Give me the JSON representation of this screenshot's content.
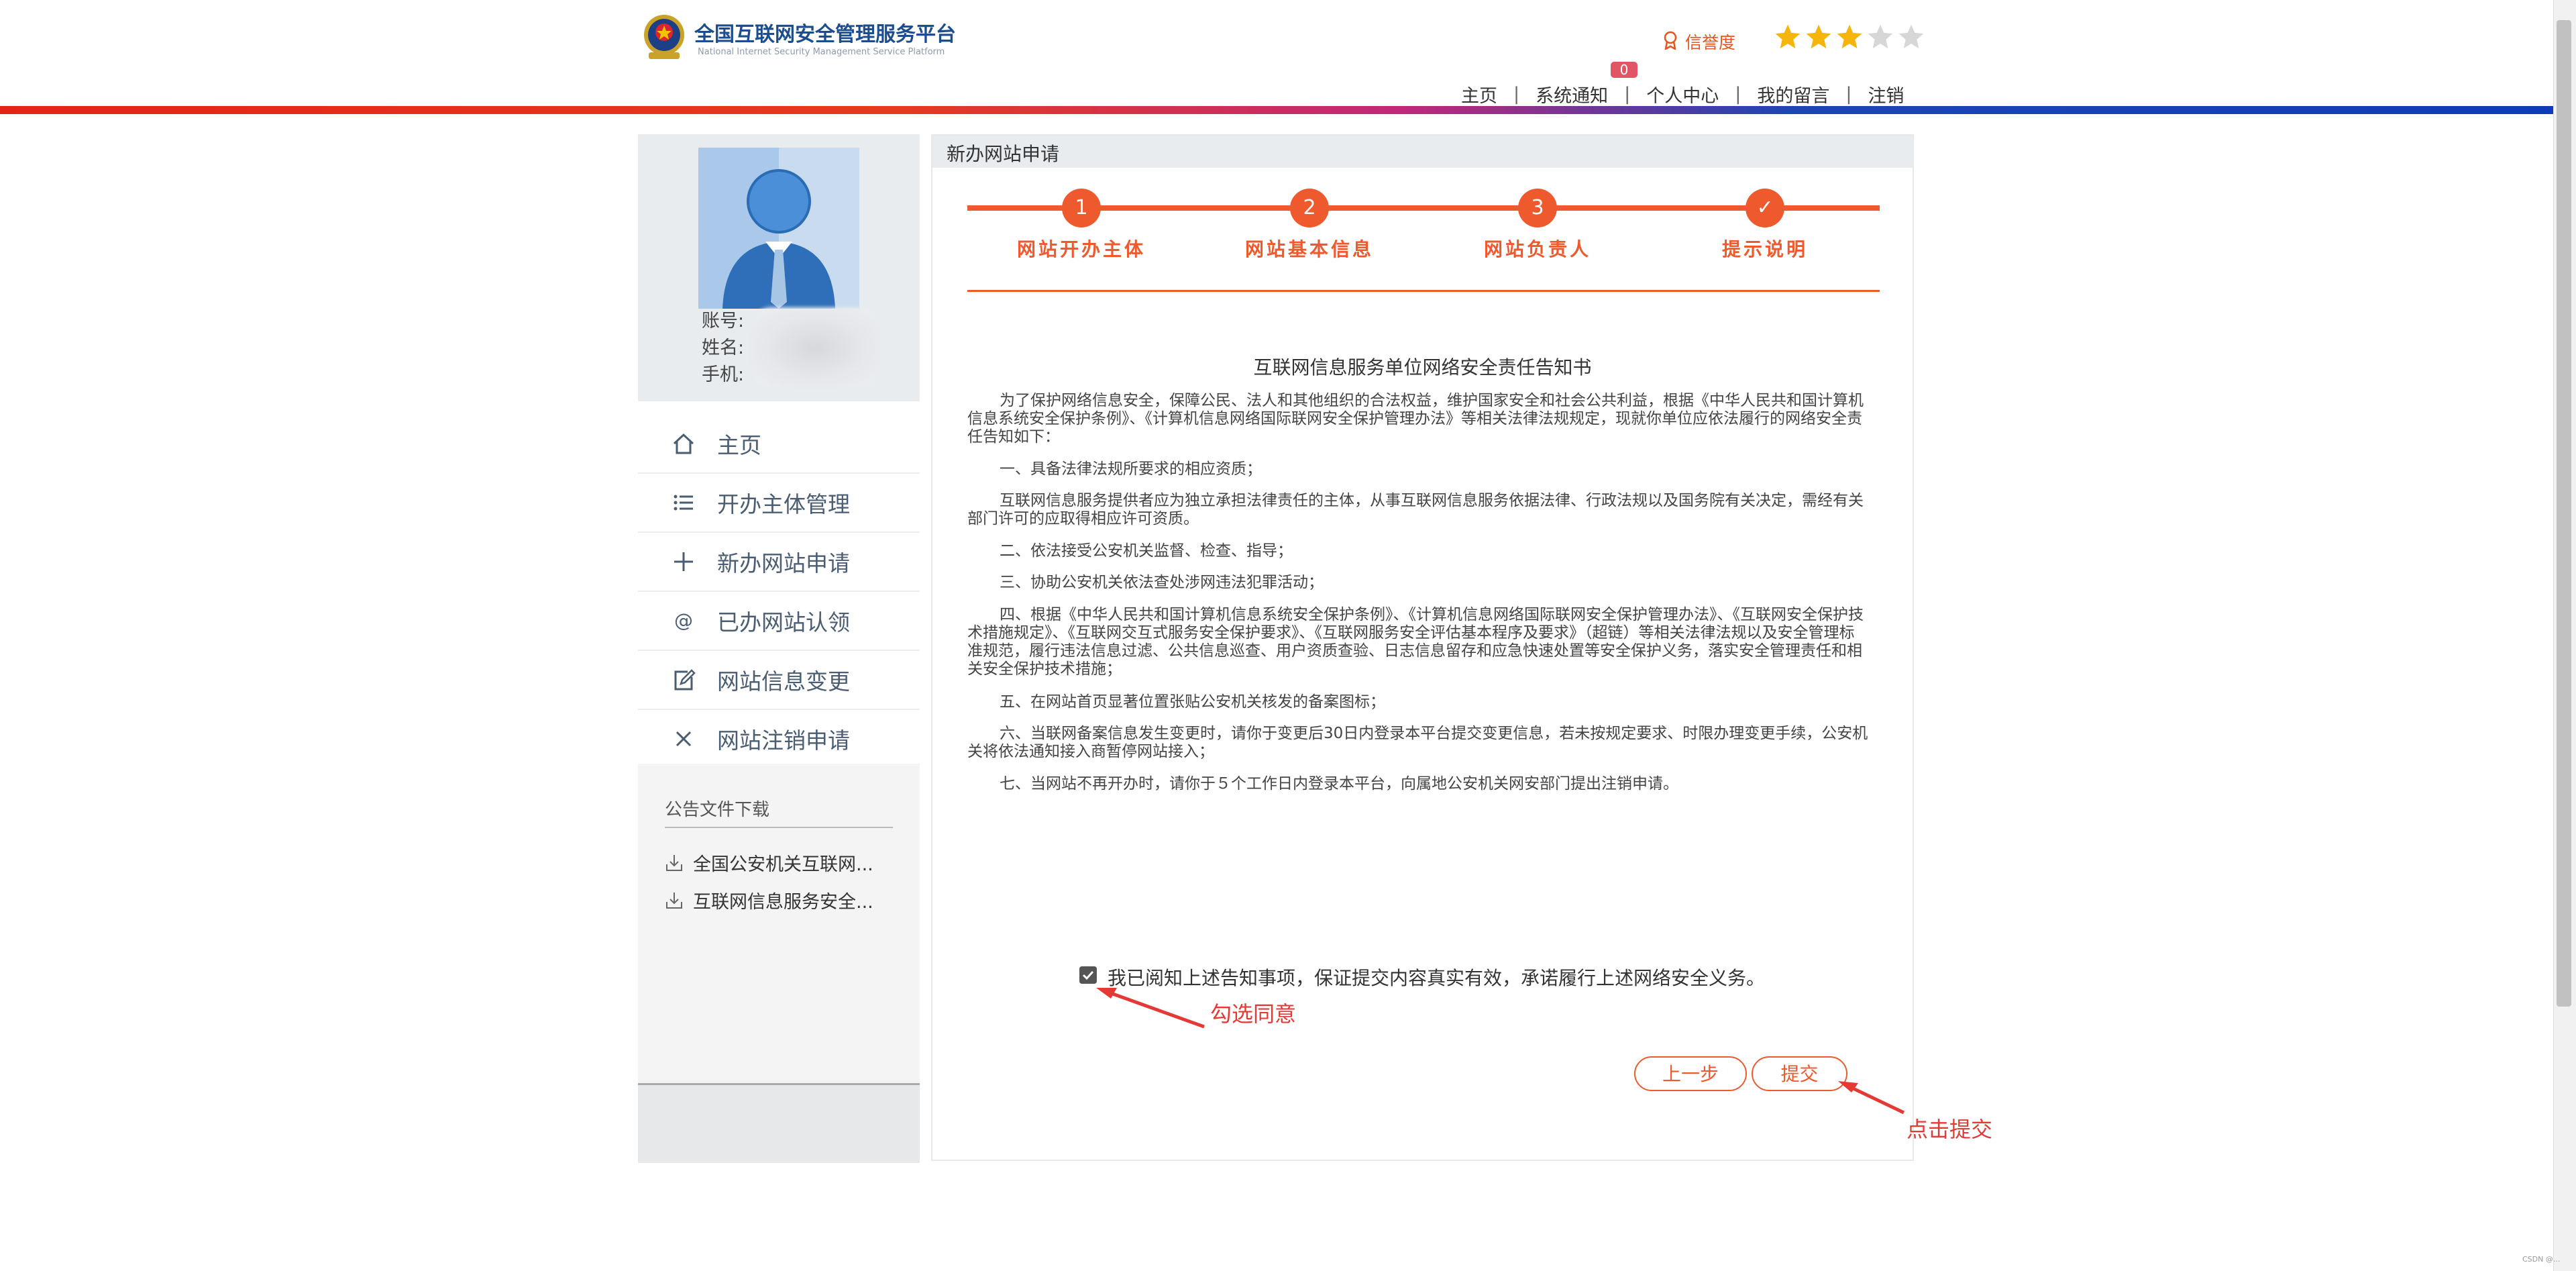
{
  "header": {
    "title": "全国互联网安全管理服务平台",
    "subtitle": "National Internet Security Management Service Platform",
    "credit_label": "信誉度",
    "stars_filled": 3,
    "stars_total": 5,
    "notice_badge": "0",
    "nav": [
      "主页",
      "系统通知",
      "个人中心",
      "我的留言",
      "注销"
    ],
    "nav_sep": "|"
  },
  "colors": {
    "accent": "#ee5a2d",
    "title_blue": "#1b4d8f",
    "annotation_red": "#e53935",
    "star_gold": "#f5b50a",
    "star_grey": "#d7d7d7"
  },
  "profile": {
    "account_label": "账号:",
    "name_label": "姓名:",
    "phone_label": "手机:"
  },
  "sidebar": {
    "items": [
      {
        "label": "主页",
        "icon": "home-icon"
      },
      {
        "label": "开办主体管理",
        "icon": "list-icon"
      },
      {
        "label": "新办网站申请",
        "icon": "plus-icon"
      },
      {
        "label": "已办网站认领",
        "icon": "at-icon"
      },
      {
        "label": "网站信息变更",
        "icon": "edit-icon"
      },
      {
        "label": "网站注销申请",
        "icon": "close-icon"
      }
    ],
    "downloads_title": "公告文件下载",
    "downloads": [
      "全国公安机关互联网...",
      "互联网信息服务安全..."
    ]
  },
  "main": {
    "panel_title": "新办网站申请",
    "steps": [
      {
        "num": "1",
        "label": "网站开办主体"
      },
      {
        "num": "2",
        "label": "网站基本信息"
      },
      {
        "num": "3",
        "label": "网站负责人"
      },
      {
        "num": "✓",
        "label": "提示说明"
      }
    ],
    "doc_title": "互联网信息服务单位网络安全责任告知书",
    "paragraphs": [
      "为了保护网络信息安全，保障公民、法人和其他组织的合法权益，维护国家安全和社会公共利益，根据《中华人民共和国计算机信息系统安全保护条例》、《计算机信息网络国际联网安全保护管理办法》等相关法律法规规定，现就你单位应依法履行的网络安全责任告知如下：",
      "一、具备法律法规所要求的相应资质；",
      "互联网信息服务提供者应为独立承担法律责任的主体，从事互联网信息服务依据法律、行政法规以及国务院有关决定，需经有关部门许可的应取得相应许可资质。",
      "二、依法接受公安机关监督、检查、指导；",
      "三、协助公安机关依法查处涉网违法犯罪活动；",
      "四、根据《中华人民共和国计算机信息系统安全保护条例》、《计算机信息网络国际联网安全保护管理办法》、《互联网安全保护技术措施规定》、《互联网交互式服务安全保护要求》、《互联网服务安全评估基本程序及要求》（超链）等相关法律法规以及安全管理标准规范，履行违法信息过滤、公共信息巡查、用户资质查验、日志信息留存和应急快速处置等安全保护义务，落实安全管理责任和相关安全保护技术措施；",
      "五、在网站首页显著位置张贴公安机关核发的备案图标；",
      "六、当联网备案信息发生变更时，请你于变更后30日内登录本平台提交变更信息，若未按规定要求、时限办理变更手续，公安机关将依法通知接入商暂停网站接入；",
      "七、当网站不再开办时，请你于５个工作日内登录本平台，向属地公安机关网安部门提出注销申请。"
    ],
    "agree_text": "我已阅知上述告知事项，保证提交内容真实有效，承诺履行上述网络安全义务。",
    "agree_checked": true,
    "btn_prev": "上一步",
    "btn_submit": "提交"
  },
  "annotations": {
    "check_hint": "勾选同意",
    "submit_hint": "点击提交"
  },
  "watermark": "CSDN @..."
}
